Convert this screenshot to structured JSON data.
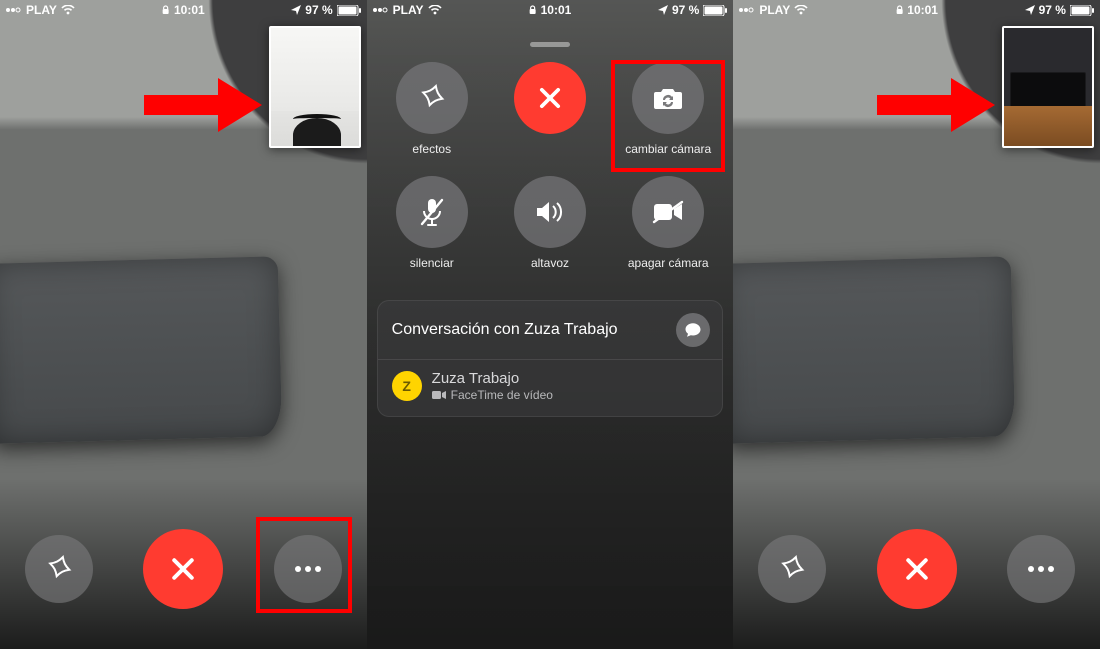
{
  "status": {
    "carrier": "PLAY",
    "time": "10:01",
    "battery_pct": "97 %"
  },
  "screen1": {
    "effects_label": "",
    "end_label": "",
    "more_label": ""
  },
  "panel": {
    "buttons": {
      "effects": "efectos",
      "end": "",
      "switch_camera": "cambiar cámara",
      "mute": "silenciar",
      "speaker": "altavoz",
      "camera_off": "apagar cámara"
    },
    "conversation_title": "Conversación con Zuza Trabajo",
    "participant": {
      "initial": "Z",
      "name": "Zuza Trabajo",
      "subtitle": "FaceTime de vídeo"
    }
  }
}
